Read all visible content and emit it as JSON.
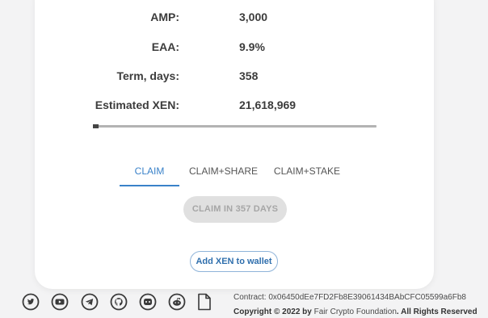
{
  "stats": [
    {
      "label": "AMP:",
      "value": "3,000"
    },
    {
      "label": "EAA:",
      "value": "9.9%"
    },
    {
      "label": "Term, days:",
      "value": "358"
    },
    {
      "label": "Estimated XEN:",
      "value": "21,618,969"
    }
  ],
  "progress": {
    "fraction": 0.003
  },
  "tabs": [
    {
      "label": "CLAIM",
      "active": true
    },
    {
      "label": "CLAIM+SHARE",
      "active": false
    },
    {
      "label": "CLAIM+STAKE",
      "active": false
    }
  ],
  "claim_button": {
    "label": "CLAIM IN 357 DAYS",
    "disabled": true
  },
  "add_wallet_button": {
    "label": "Add XEN to wallet"
  },
  "footer": {
    "contract": "Contract: 0x06450dEe7FD2Fb8E39061434BAbCFC05599a6Fb8",
    "copyright_prefix": "Copyright © 2022 by ",
    "copyright_org": "Fair Crypto Foundation",
    "copyright_suffix": ". All Rights Reserved"
  },
  "social_icons": [
    "twitter-icon",
    "youtube-icon",
    "telegram-icon",
    "github-icon",
    "discord-icon",
    "reddit-icon",
    "document-icon"
  ],
  "colors": {
    "accent": "#3a82c9",
    "card": "#ffffff",
    "background": "#f3f3f4"
  }
}
